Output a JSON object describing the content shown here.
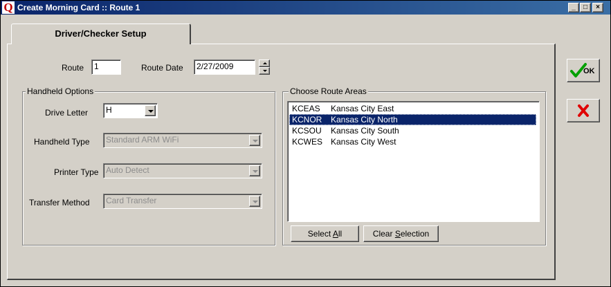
{
  "window": {
    "title": "Create Morning Card :: Route 1",
    "logo": "Q"
  },
  "caption_buttons": {
    "minimize": "_",
    "maximize": "□",
    "close": "×"
  },
  "tab": {
    "label": "Driver/Checker Setup"
  },
  "route": {
    "label": "Route",
    "value": "1"
  },
  "route_date": {
    "label": "Route Date",
    "value": "2/27/2009"
  },
  "handheld_options": {
    "title": "Handheld Options",
    "drive_letter": {
      "label": "Drive Letter",
      "value": "H"
    },
    "handheld_type": {
      "label": "Handheld Type",
      "value": "Standard ARM WiFi"
    },
    "printer_type": {
      "label": "Printer Type",
      "value": "Auto Detect"
    },
    "transfer_method": {
      "label": "Transfer Method",
      "value": "Card Transfer"
    }
  },
  "route_areas": {
    "title": "Choose Route Areas",
    "items": [
      {
        "code": "KCEAS",
        "name": "Kansas City East",
        "selected": false
      },
      {
        "code": "KCNOR",
        "name": "Kansas City North",
        "selected": true
      },
      {
        "code": "KCSOU",
        "name": "Kansas City South",
        "selected": false
      },
      {
        "code": "KCWES",
        "name": "Kansas City West",
        "selected": false
      }
    ],
    "select_all_pre": "Select ",
    "select_all_key": "A",
    "select_all_post": "ll",
    "clear_pre": "Clear ",
    "clear_key": "S",
    "clear_post": "election"
  },
  "actions": {
    "ok_label": "OK",
    "ok_color": "#00a000",
    "cancel_color": "#e00000"
  },
  "icons": {
    "ok": "checkmark-icon",
    "cancel": "x-icon"
  }
}
